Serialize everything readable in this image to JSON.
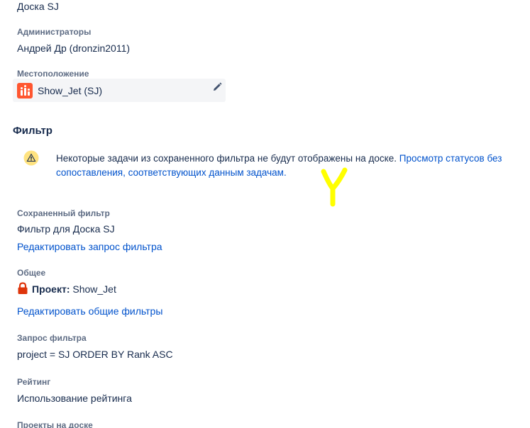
{
  "board": {
    "name": "Доска SJ",
    "admins_label": "Администраторы",
    "admins_value": "Андрей Др (dronzin2011)",
    "location_label": "Местоположение",
    "location_value": "Show_Jet (SJ)"
  },
  "filter": {
    "section_title": "Фильтр",
    "warning_text": "Некоторые задачи из сохраненного фильтра не будут отображены на доске.",
    "warning_link": "Просмотр статусов без сопоставления, соответствующих данным задачам",
    "warning_tail": ".",
    "saved_filter_label": "Сохраненный фильтр",
    "saved_filter_value": "Фильтр для Доска SJ",
    "edit_query_link": "Редактировать запрос фильтра",
    "shared_label": "Общее",
    "shared_project_prefix": "Проект:",
    "shared_project_value": "Show_Jet",
    "edit_shared_link": "Редактировать общие фильтры",
    "query_label": "Запрос фильтра",
    "query_value": "project = SJ ORDER BY Rank ASC",
    "ranking_label": "Рейтинг",
    "ranking_value": "Использование рейтинга",
    "projects_label": "Проекты на доске"
  },
  "icons": {
    "project_avatar": "project-avatar-icon",
    "edit": "pencil-icon",
    "warning": "warning-icon",
    "lock": "lock-icon",
    "annotation": "yellow-y-mark"
  },
  "colors": {
    "link": "#0052cc",
    "text": "#172b4d",
    "muted": "#5e6c84",
    "avatar": "#ff5630",
    "warning": "#ffab00",
    "lock": "#de350b",
    "annotation": "#ffff00"
  }
}
